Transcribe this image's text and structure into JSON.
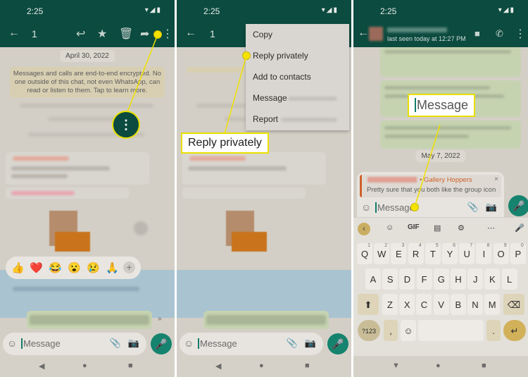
{
  "status": {
    "time": "2:25",
    "icons": "wifi signal battery"
  },
  "panel1": {
    "selected_count": "1",
    "toolbar_icons": [
      "back-arrow",
      "reply",
      "star",
      "delete",
      "forward",
      "more-options"
    ],
    "date_chip": "April 30, 2022",
    "encryption_notice": "Messages and calls are end-to-end encrypted. No one outside of this chat, not even WhatsApp, can read or listen to them. Tap to learn more.",
    "reactions": [
      "👍",
      "❤️",
      "😂",
      "😮",
      "😢",
      "🙏"
    ],
    "reaction_add": "+",
    "input_placeholder": "Message"
  },
  "panel2": {
    "selected_count": "1",
    "menu_items": [
      "Copy",
      "Reply privately",
      "Add to contacts",
      "Message",
      "Report"
    ],
    "callout_label": "Reply privately",
    "input_placeholder": "Message"
  },
  "panel3": {
    "last_seen": "last seen today at 12:27 PM",
    "callout_label": "Message",
    "date_chip": "May 7, 2022",
    "reply_group": "• Gallery Hoppers",
    "reply_text": "Pretty sure that you both like the group icon",
    "reply_close": "×",
    "input_placeholder": "Message",
    "keyboard": {
      "tools": [
        "‹",
        "GIF",
        "⋯"
      ],
      "row1": [
        "Q",
        "W",
        "E",
        "R",
        "T",
        "Y",
        "U",
        "I",
        "O",
        "P"
      ],
      "row1_hints": [
        "1",
        "2",
        "3",
        "4",
        "5",
        "6",
        "7",
        "8",
        "9",
        "0"
      ],
      "row2": [
        "A",
        "S",
        "D",
        "F",
        "G",
        "H",
        "J",
        "K",
        "L"
      ],
      "row3": [
        "Z",
        "X",
        "C",
        "V",
        "B",
        "N",
        "M"
      ],
      "symbols_key": "?123",
      "comma": ",",
      "period": "."
    }
  },
  "colors": {
    "header": "#0c4b3f",
    "accent": "#15836e",
    "callout": "#f5e300"
  }
}
